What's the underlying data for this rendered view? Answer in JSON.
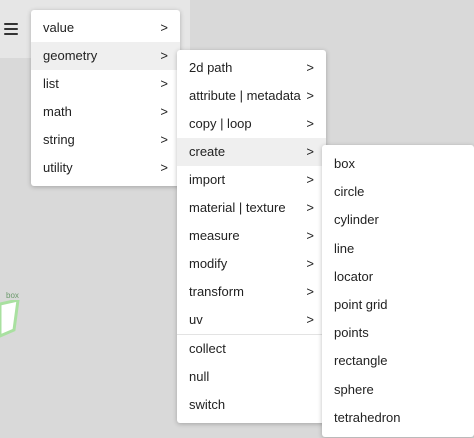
{
  "node": {
    "label": "box"
  },
  "root_menu": {
    "items": [
      {
        "label": "value",
        "chevron": ">"
      },
      {
        "label": "geometry",
        "chevron": ">"
      },
      {
        "label": "list",
        "chevron": ">"
      },
      {
        "label": "math",
        "chevron": ">"
      },
      {
        "label": "string",
        "chevron": ">"
      },
      {
        "label": "utility",
        "chevron": ">"
      }
    ]
  },
  "geometry_menu": {
    "items": [
      {
        "label": "2d path",
        "chevron": ">"
      },
      {
        "label": "attribute | metadata",
        "chevron": ">"
      },
      {
        "label": "copy | loop",
        "chevron": ">"
      },
      {
        "label": "create",
        "chevron": ">"
      },
      {
        "label": "import",
        "chevron": ">"
      },
      {
        "label": "material | texture",
        "chevron": ">"
      },
      {
        "label": "measure",
        "chevron": ">"
      },
      {
        "label": "modify",
        "chevron": ">"
      },
      {
        "label": "transform",
        "chevron": ">"
      },
      {
        "label": "uv",
        "chevron": ">"
      }
    ],
    "extra_items": [
      {
        "label": "collect"
      },
      {
        "label": "null"
      },
      {
        "label": "switch"
      }
    ]
  },
  "create_menu": {
    "items": [
      {
        "label": "box"
      },
      {
        "label": "circle"
      },
      {
        "label": "cylinder"
      },
      {
        "label": "line"
      },
      {
        "label": "locator"
      },
      {
        "label": "point grid"
      },
      {
        "label": "points"
      },
      {
        "label": "rectangle"
      },
      {
        "label": "sphere"
      },
      {
        "label": "tetrahedron"
      }
    ]
  },
  "colors": {
    "canvas": "#d9d9d9",
    "menu_bg": "#ffffff",
    "active_bg": "#efefef",
    "node_outline": "#a9e0a0"
  },
  "icons": {
    "menu": "hamburger-icon",
    "submenu": "chevron-right-icon"
  }
}
